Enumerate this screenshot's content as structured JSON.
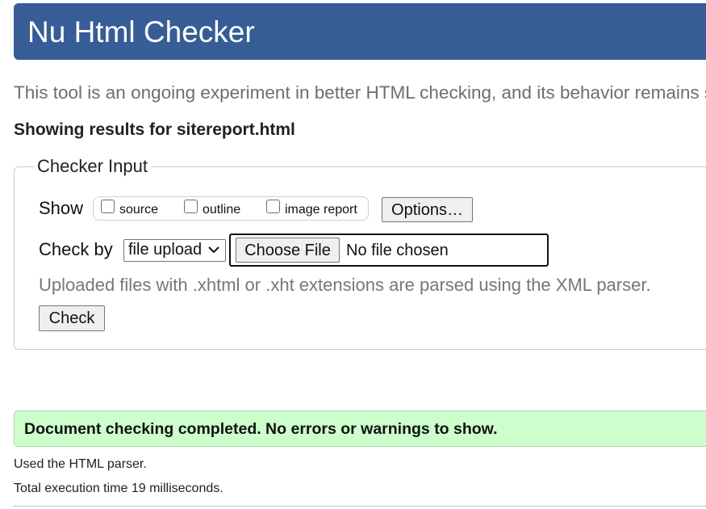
{
  "header": {
    "title": "Nu Html Checker"
  },
  "intro": "This tool is an ongoing experiment in better HTML checking, and its behavior remains subject to change",
  "results_for": "Showing results for sitereport.html",
  "checker_input": {
    "legend": "Checker Input",
    "show_label": "Show",
    "show_options": [
      {
        "label": "source",
        "checked": false
      },
      {
        "label": "outline",
        "checked": false
      },
      {
        "label": "image report",
        "checked": false
      }
    ],
    "options_button": "Options…",
    "check_by_label": "Check by",
    "check_by_value": "file upload",
    "choose_file_button": "Choose File",
    "file_status": "No file chosen",
    "hint": "Uploaded files with .xhtml or .xht extensions are parsed using the XML parser.",
    "check_button": "Check"
  },
  "result": {
    "message": "Document checking completed. No errors or warnings to show.",
    "parser": "Used the HTML parser.",
    "execution_time": "Total execution time 19 milliseconds."
  }
}
